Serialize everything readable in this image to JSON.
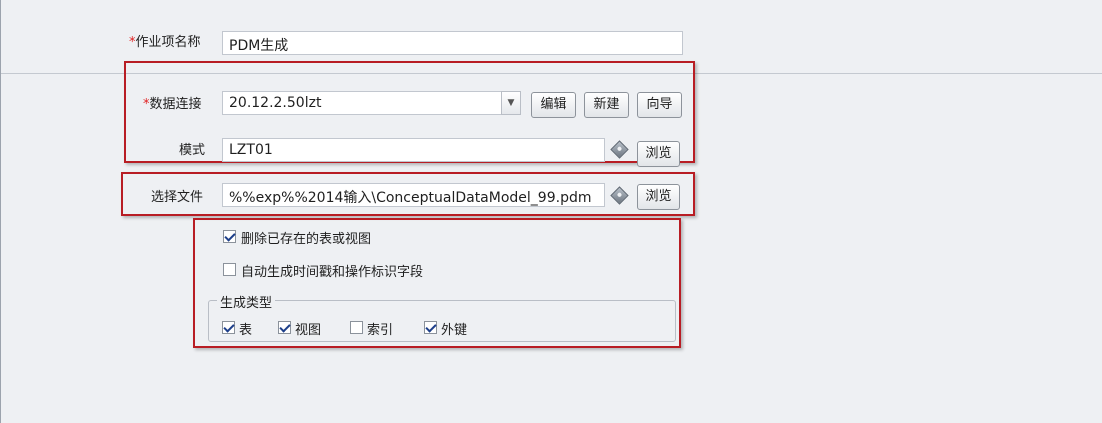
{
  "task_name": {
    "label": "作业项名称",
    "value": "PDM生成"
  },
  "connection": {
    "data_connection_label": "数据连接",
    "data_connection_value": "20.12.2.50lzt",
    "edit_label": "编辑",
    "new_label": "新建",
    "wizard_label": "向导",
    "schema_label": "模式",
    "schema_value": "LZT01",
    "browse_label": "浏览"
  },
  "file": {
    "label": "选择文件",
    "value": "%%exp%%2014输入\\ConceptualDataModel_99.pdm",
    "browse_label": "浏览"
  },
  "options": {
    "drop_existing": {
      "label": "删除已存在的表或视图",
      "checked": true
    },
    "auto_timestamp": {
      "label": "自动生成时间戳和操作标识字段",
      "checked": false
    },
    "gen_type_title": "生成类型",
    "types": [
      {
        "label": "表",
        "checked": true
      },
      {
        "label": "视图",
        "checked": true
      },
      {
        "label": "索引",
        "checked": false
      },
      {
        "label": "外键",
        "checked": true
      }
    ]
  },
  "required_mark": "*",
  "colors": {
    "highlight_border": "#b81d24",
    "required": "#e02020",
    "check": "#1d3f8a"
  }
}
